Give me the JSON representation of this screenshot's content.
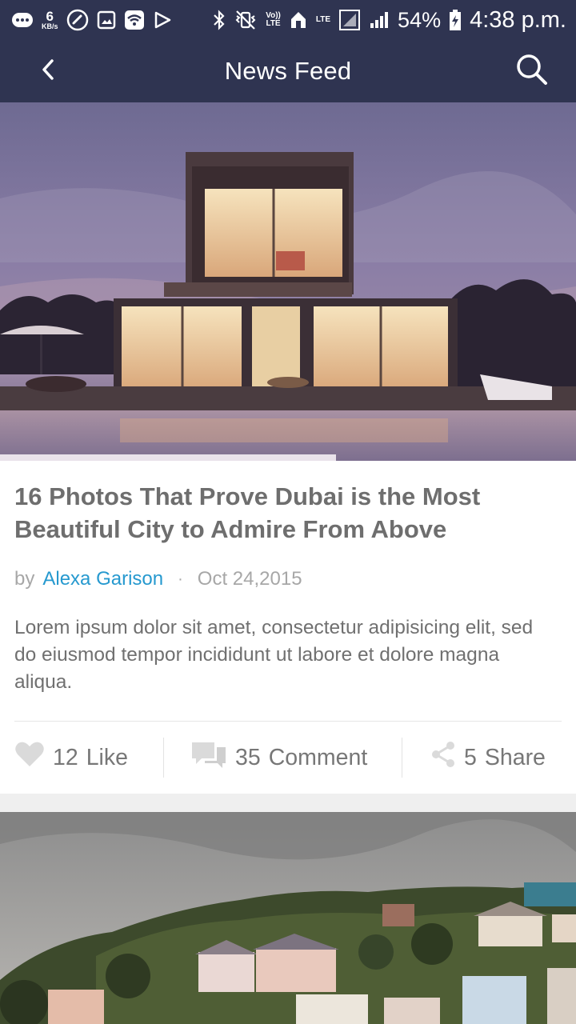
{
  "status_bar": {
    "net_speed": "6",
    "net_unit": "KB/s",
    "volte_label": "Vo))\nLTE",
    "lte_label": "LTE",
    "battery": "54%",
    "time": "4:38 p.m."
  },
  "app_bar": {
    "title": "News Feed"
  },
  "post": {
    "title": "16 Photos That Prove Dubai is the Most Beautiful City to Admire From Above",
    "by": "by",
    "author": "Alexa Garison",
    "separator": "·",
    "date": "Oct 24,2015",
    "excerpt": "Lorem ipsum dolor sit amet, consectetur adipisicing elit, sed do eiusmod tempor incididunt ut labore et dolore magna aliqua.",
    "actions": {
      "like_count": "12",
      "like_label": "Like",
      "comment_count": "35",
      "comment_label": "Comment",
      "share_count": "5",
      "share_label": "Share"
    }
  },
  "colors": {
    "header_bg": "#2f3451",
    "author_link": "#2699cf",
    "title_text": "#6e6e6e",
    "meta_text": "#a7a7a7"
  },
  "icons": {
    "back": "chevron-left-icon",
    "search": "search-icon",
    "like": "heart-icon",
    "comment": "comment-icon",
    "share": "share-icon"
  }
}
